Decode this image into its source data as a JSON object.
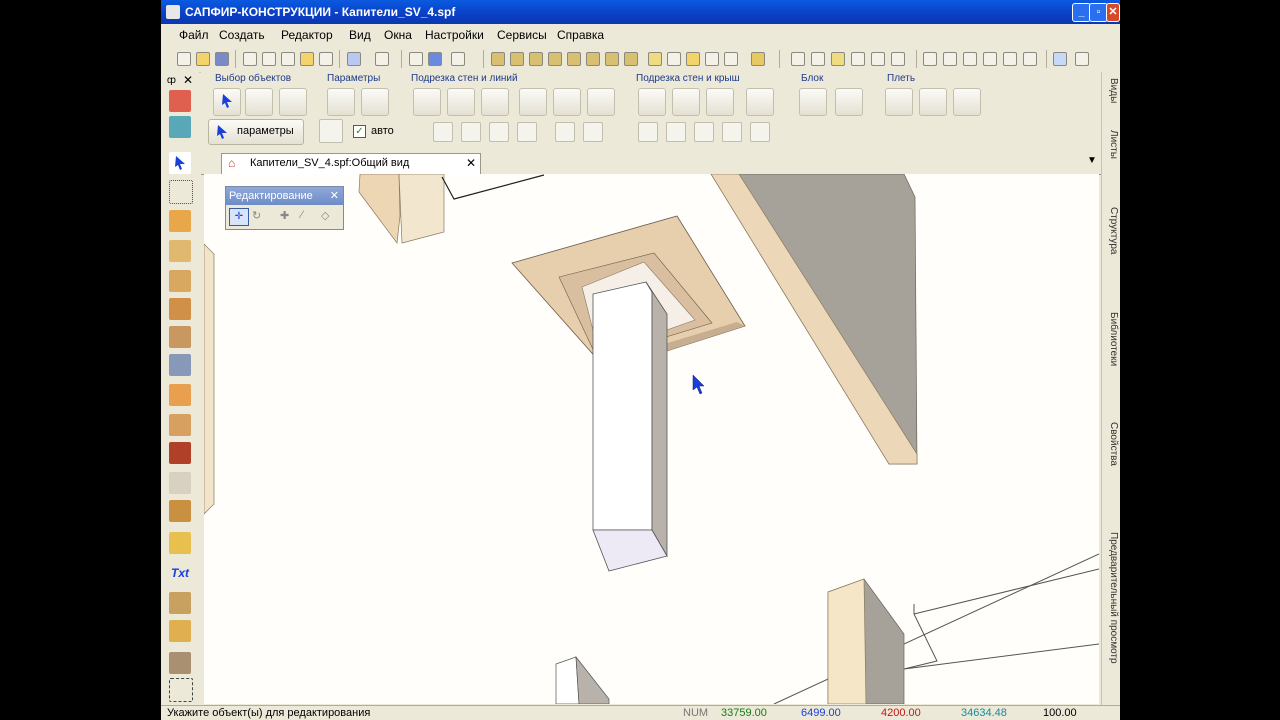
{
  "window": {
    "title": "САПФИР-КОНСТРУКЦИИ - Капители_SV_4.spf"
  },
  "menu": [
    "Файл",
    "Создать",
    "Редактор",
    "Вид",
    "Окна",
    "Настройки",
    "Сервисы",
    "Справка"
  ],
  "ribbon": {
    "groups": [
      "Выбор объектов",
      "Параметры",
      "Подрезка стен и линий",
      "Подрезка стен и крыш",
      "Блок",
      "Плеть"
    ],
    "param_button": "параметры",
    "auto_checkbox_label": "авто",
    "auto_checked": true
  },
  "doc_tab": {
    "label": "Капители_SV_4.spf:Общий вид"
  },
  "edit_panel": {
    "title": "Редактирование"
  },
  "right_tabs": [
    "Виды",
    "Листы",
    "Структура",
    "Библиотеки",
    "Свойства",
    "Предварительный просмотр"
  ],
  "status": {
    "prompt": "Укажите объект(ы) для редактирования",
    "num": "NUM",
    "v1": "33759.00",
    "v2": "6499.00",
    "v3": "4200.00",
    "v4": "34634.48",
    "v5": "100.00"
  },
  "colors": {
    "title_bar": "#0a3fc4",
    "status_v1": "#1a7a1a",
    "status_v3": "#c01818",
    "status_v4": "#1a8a9a",
    "selection_cursor": "#1a3ed8"
  }
}
